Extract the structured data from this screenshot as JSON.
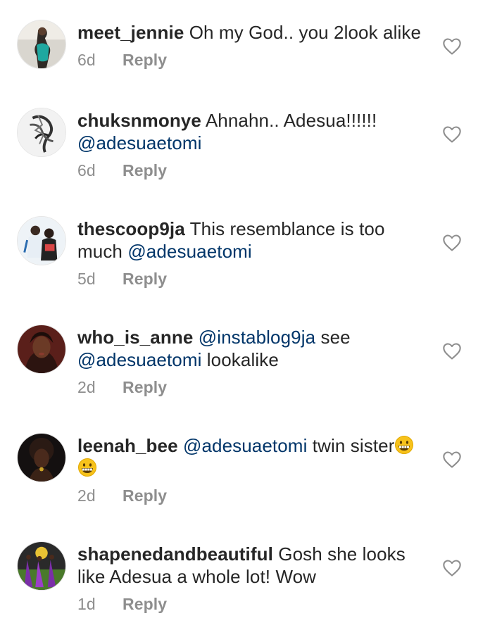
{
  "comments": [
    {
      "username": "meet_jennie",
      "segments": [
        {
          "type": "text",
          "value": " Oh my God.. you 2look alike"
        }
      ],
      "time": "6d",
      "reply": "Reply"
    },
    {
      "username": "chuksnmonye",
      "segments": [
        {
          "type": "text",
          "value": " Ahnahn.. Adesua!!!!!! "
        },
        {
          "type": "mention",
          "value": "@adesuaetomi"
        }
      ],
      "time": "6d",
      "reply": "Reply"
    },
    {
      "username": "thescoop9ja",
      "segments": [
        {
          "type": "text",
          "value": " This resemblance is too much "
        },
        {
          "type": "mention",
          "value": "@adesuaetomi"
        }
      ],
      "time": "5d",
      "reply": "Reply"
    },
    {
      "username": "who_is_anne",
      "segments": [
        {
          "type": "text",
          "value": " "
        },
        {
          "type": "mention",
          "value": "@instablog9ja"
        },
        {
          "type": "text",
          "value": " see "
        },
        {
          "type": "mention",
          "value": "@adesuaetomi"
        },
        {
          "type": "text",
          "value": " lookalike"
        }
      ],
      "time": "2d",
      "reply": "Reply"
    },
    {
      "username": "leenah_bee",
      "segments": [
        {
          "type": "text",
          "value": " "
        },
        {
          "type": "mention",
          "value": "@adesuaetomi"
        },
        {
          "type": "text",
          "value": " twin sister"
        },
        {
          "type": "emoji",
          "value": "grinning-face"
        },
        {
          "type": "text",
          "value": " "
        },
        {
          "type": "emoji",
          "value": "grinning-face"
        }
      ],
      "time": "2d",
      "reply": "Reply"
    },
    {
      "username": "shapenedandbeautiful",
      "segments": [
        {
          "type": "text",
          "value": " Gosh she looks like Adesua a whole lot! Wow"
        }
      ],
      "time": "1d",
      "reply": "Reply"
    }
  ],
  "colors": {
    "mention": "#003569",
    "username": "#262626",
    "meta": "#8e8e8e",
    "icon": "#8e8e8e"
  },
  "icons": {
    "like": "heart-outline-icon",
    "emoji": "grinning-face"
  }
}
